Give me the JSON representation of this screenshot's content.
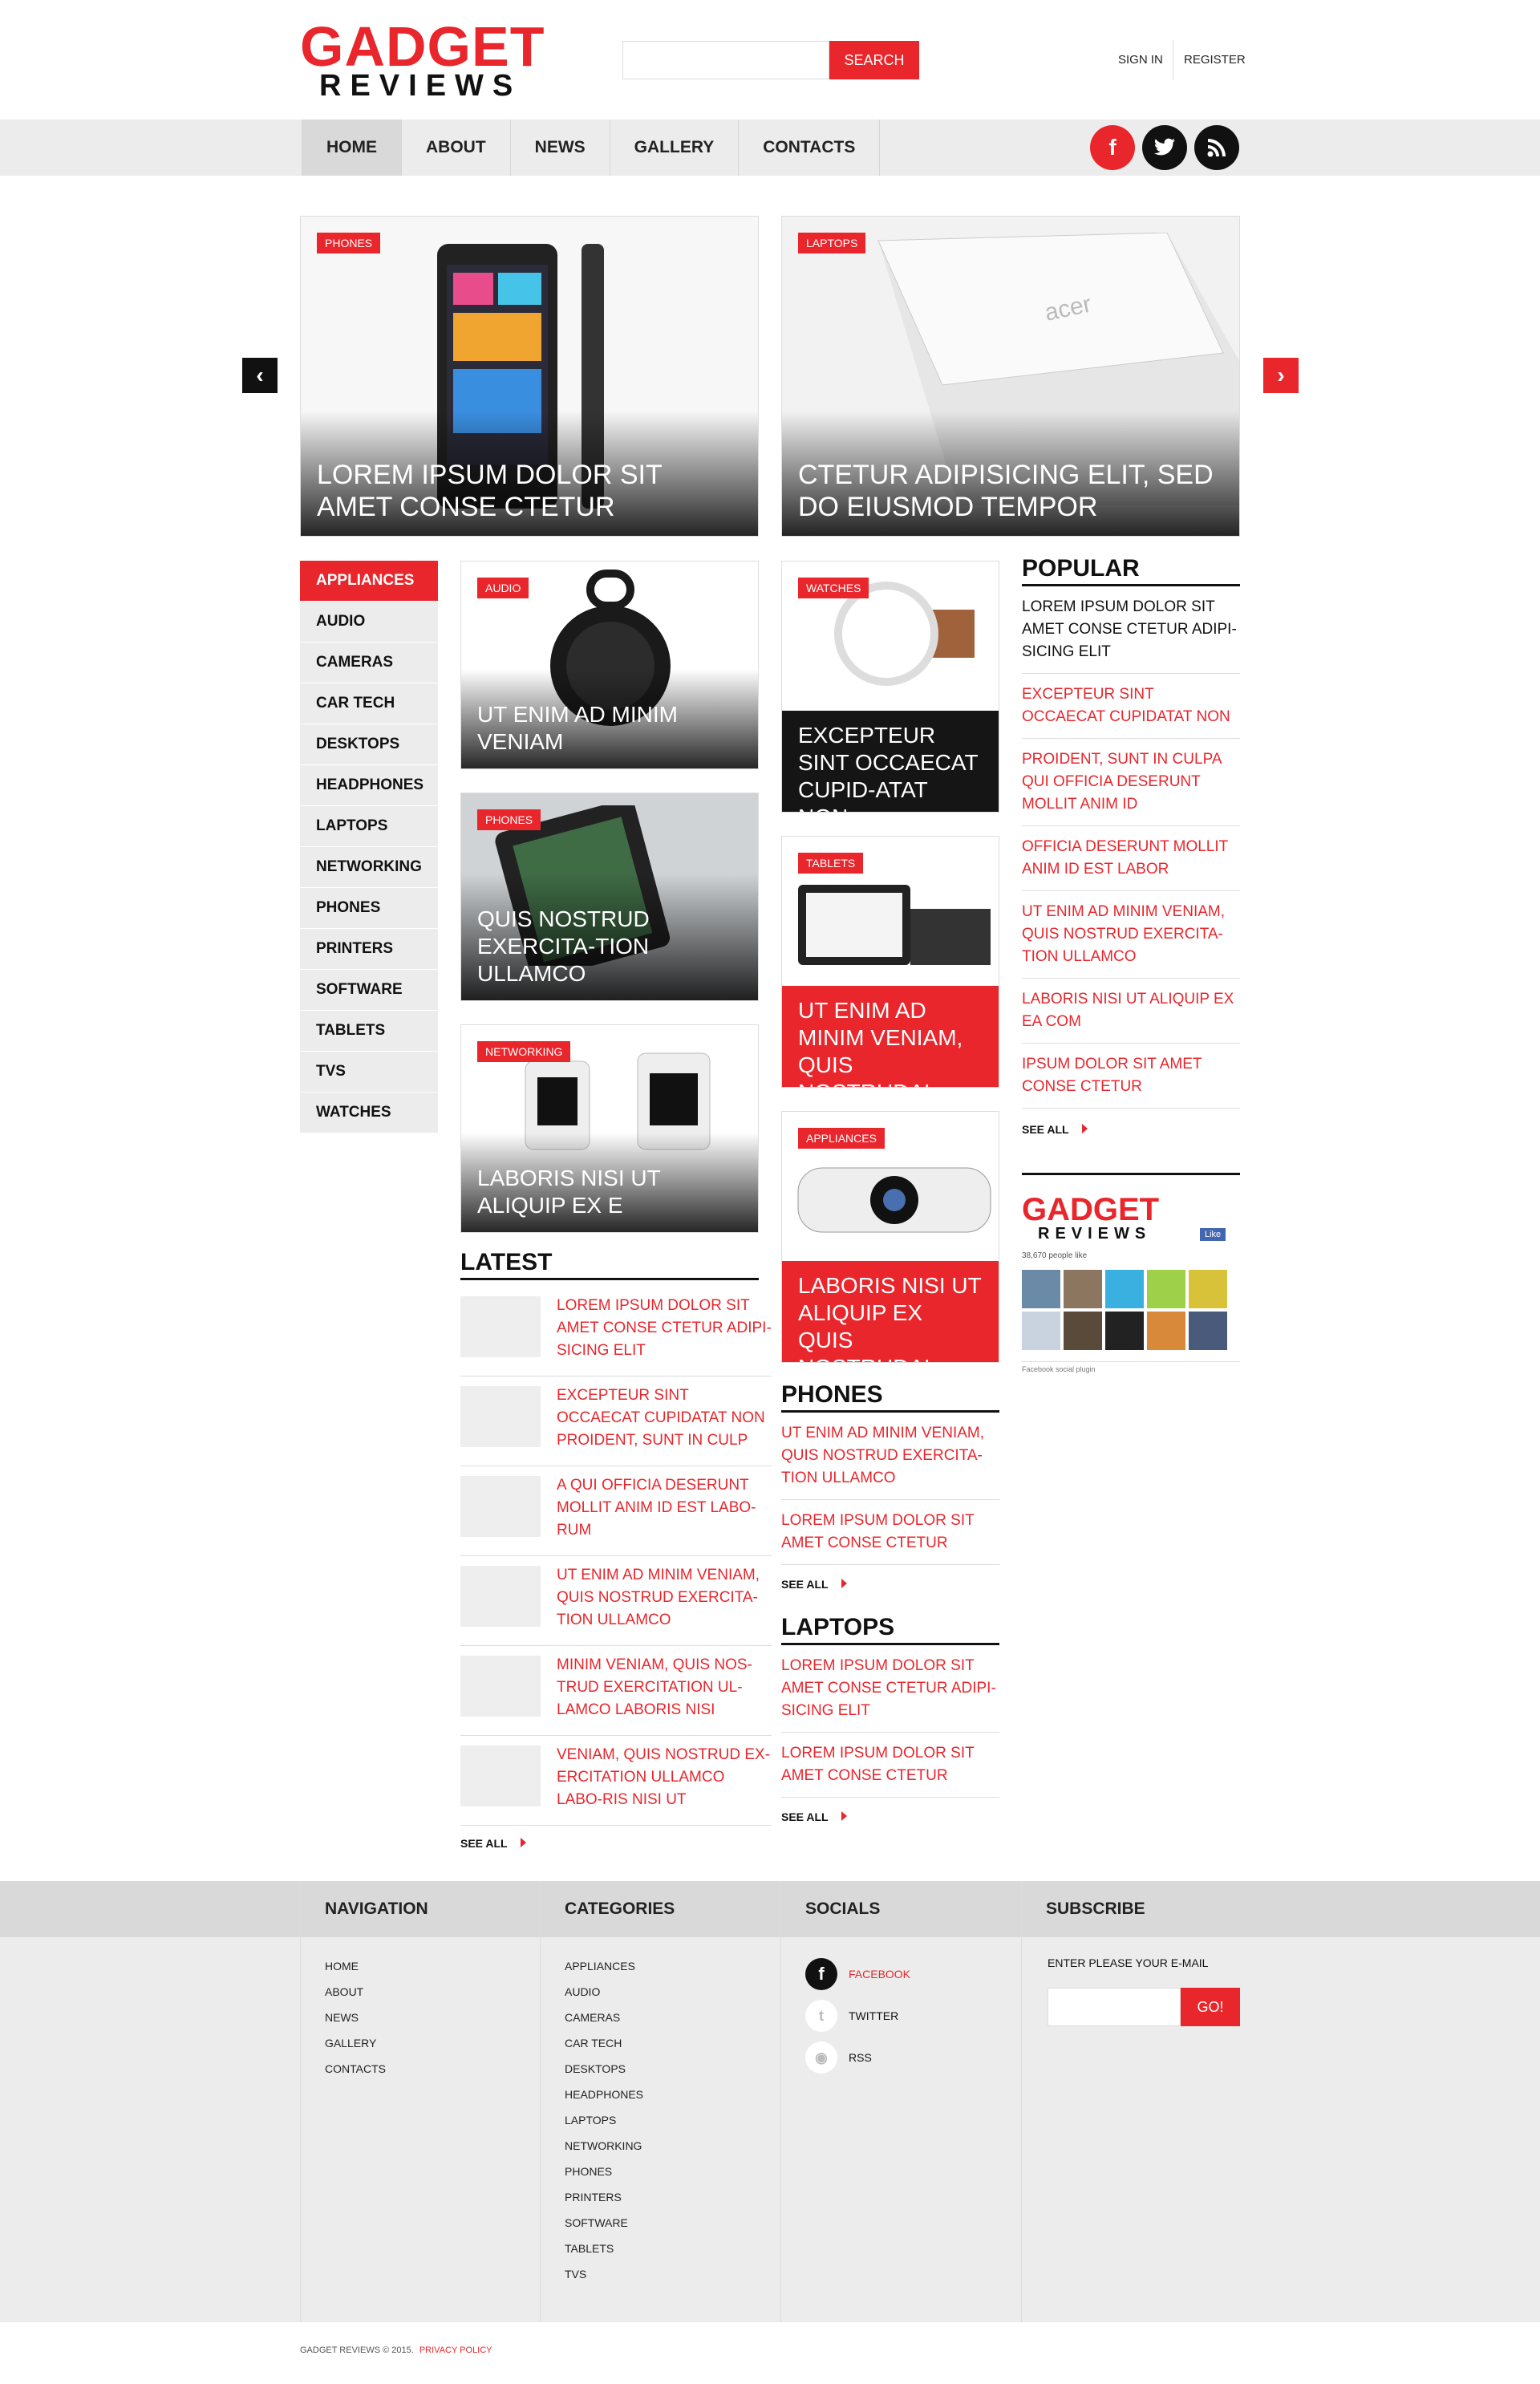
{
  "brand": {
    "line1": "GADGET",
    "line2": "REVIEWS"
  },
  "search": {
    "button": "SEARCH",
    "placeholder": ""
  },
  "account": {
    "signin": "SIGN IN",
    "register": "REGISTER"
  },
  "nav": [
    "HOME",
    "ABOUT",
    "NEWS",
    "GALLERY",
    "CONTACTS"
  ],
  "colors": {
    "accent": "#e8262c",
    "nav_bg": "#ececec",
    "dark": "#151515"
  },
  "slider": [
    {
      "tag": "PHONES",
      "title": "LOREM IPSUM DOLOR SIT AMET CONSE CTETUR"
    },
    {
      "tag": "LAPTOPS",
      "title": "CTETUR ADIPISICING ELIT, SED DO EIUSMOD TEMPOR"
    }
  ],
  "categories": [
    "APPLIANCES",
    "AUDIO",
    "CAMERAS",
    "CAR TECH",
    "DESKTOPS",
    "HEADPHONES",
    "LAPTOPS",
    "NETWORKING",
    "PHONES",
    "PRINTERS",
    "SOFTWARE",
    "TABLETS",
    "TVS",
    "WATCHES"
  ],
  "grid": [
    {
      "tag": "AUDIO",
      "title": "UT ENIM AD MINIM VENIAM"
    },
    {
      "tag": "PHONES",
      "title": "QUIS NOSTRUD EXERCITA-TION ULLAMCO"
    },
    {
      "tag": "NETWORKING",
      "title": "LABORIS NISI UT ALIQUIP EX E"
    },
    {
      "tag": "WATCHES",
      "title": "EXCEPTEUR SINT OCCAECAT CUPID-ATAT NON"
    },
    {
      "tag": "TABLETS",
      "title": "UT ENIM AD MINIM VENIAM, QUIS NOSTRUDAL"
    },
    {
      "tag": "APPLIANCES",
      "title": "LABORIS NISI UT ALIQUIP EX QUIS NOSTRUDAL"
    }
  ],
  "popular": {
    "title": "POPULAR",
    "items": [
      "LOREM IPSUM DOLOR SIT AMET CONSE CTETUR ADIPI-SICING ELIT",
      "EXCEPTEUR SINT OCCAECAT CUPIDATAT NON",
      "PROIDENT, SUNT IN CULPA QUI OFFICIA DESERUNT MOLLIT ANIM ID",
      "OFFICIA DESERUNT MOLLIT ANIM ID EST LABOR",
      "UT ENIM AD MINIM VENIAM, QUIS NOSTRUD EXERCITA-TION ULLAMCO",
      "LABORIS NISI UT ALIQUIP EX EA COM",
      "IPSUM DOLOR SIT AMET CONSE CTETUR"
    ],
    "see_all": "SEE ALL"
  },
  "fb": {
    "logo1": "GADGET",
    "logo2": "REVIEWS",
    "like": "Like",
    "count": "38,670 people like",
    "plugin": "Facebook social plugin"
  },
  "latest": {
    "title": "LATEST",
    "items": [
      "LOREM IPSUM DOLOR SIT AMET CONSE CTETUR ADIPI-SICING ELIT",
      "EXCEPTEUR SINT OCCAECAT CUPIDATAT NON PROIDENT, SUNT IN CULP",
      "A QUI OFFICIA DESERUNT MOLLIT ANIM ID EST LABO-RUM",
      "UT ENIM AD MINIM VENIAM, QUIS NOSTRUD EXERCITA-TION ULLAMCO",
      "MINIM VENIAM, QUIS NOS-TRUD EXERCITATION UL-LAMCO LABORIS NISI",
      "VENIAM, QUIS NOSTRUD EX-ERCITATION ULLAMCO LABO-RIS NISI UT"
    ],
    "see_all": "SEE ALL"
  },
  "phones": {
    "title": "PHONES",
    "items": [
      "UT ENIM AD MINIM VENIAM, QUIS NOSTRUD EXERCITA-TION ULLAMCO",
      "LOREM IPSUM DOLOR SIT AMET CONSE CTETUR"
    ],
    "see_all": "SEE ALL"
  },
  "laptops": {
    "title": "LAPTOPS",
    "items": [
      "LOREM IPSUM DOLOR SIT AMET CONSE CTETUR ADIPI-SICING ELIT",
      "LOREM IPSUM DOLOR SIT AMET CONSE CTETUR"
    ],
    "see_all": "SEE ALL"
  },
  "footer": {
    "navigation": {
      "title": "NAVIGATION",
      "items": [
        "HOME",
        "ABOUT",
        "NEWS",
        "GALLERY",
        "CONTACTS"
      ]
    },
    "categories": {
      "title": "CATEGORIES",
      "items": [
        "APPLIANCES",
        "AUDIO",
        "CAMERAS",
        "CAR TECH",
        "DESKTOPS",
        "HEADPHONES",
        "LAPTOPS",
        "NETWORKING",
        "PHONES",
        "PRINTERS",
        "SOFTWARE",
        "TABLETS",
        "TVS"
      ]
    },
    "socials": {
      "title": "SOCIALS",
      "items": [
        "FACEBOOK",
        "TWITTER",
        "RSS"
      ]
    },
    "subscribe": {
      "title": "SUBSCRIBE",
      "label": "ENTER PLEASE YOUR E-MAIL",
      "button": "GO!"
    },
    "copyright": "GADGET REVIEWS © 2015.",
    "privacy": "PRIVACY POLICY"
  }
}
